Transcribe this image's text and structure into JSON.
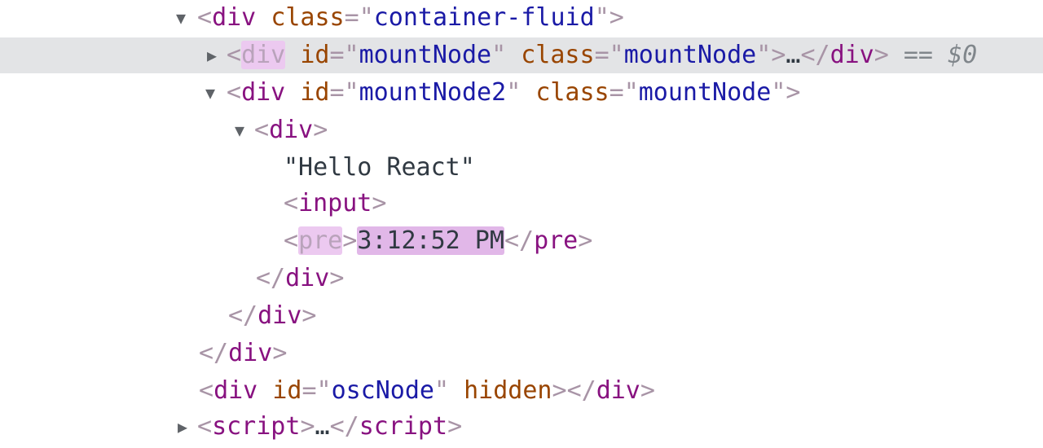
{
  "dom_tree": {
    "row1": {
      "open": "<",
      "tag": "div",
      "attr": "class",
      "eq": "=",
      "q1": "\"",
      "value": "container-fluid",
      "q2": "\"",
      "close": ">"
    },
    "row2": {
      "open": "<",
      "tag": "div",
      "attr1": "id",
      "eq1": "=",
      "q1": "\"",
      "value1": "mountNode",
      "q2": "\"",
      "attr2": "class",
      "eq2": "=",
      "q3": "\"",
      "value2": "mountNode",
      "q4": "\"",
      "close": ">",
      "ellipsis": "…",
      "end_open": "</",
      "end_tag": "div",
      "end_close": ">",
      "ref_eq": "==",
      "ref": "$0"
    },
    "row3": {
      "open": "<",
      "tag": "div",
      "attr1": "id",
      "eq1": "=",
      "q1": "\"",
      "value1": "mountNode2",
      "q2": "\"",
      "attr2": "class",
      "eq2": "=",
      "q3": "\"",
      "value2": "mountNode",
      "q4": "\"",
      "close": ">"
    },
    "row4": {
      "open": "<",
      "tag": "div",
      "close": ">"
    },
    "row5": {
      "text": "\"Hello React\""
    },
    "row6": {
      "open": "<",
      "tag": "input",
      "close": ">"
    },
    "row7": {
      "open": "<",
      "tag": "pre",
      "close": ">",
      "text": "3:12:52 PM",
      "end_open": "</",
      "end_tag": "pre",
      "end_close": ">"
    },
    "row8": {
      "end_open": "</",
      "end_tag": "div",
      "end_close": ">"
    },
    "row9": {
      "end_open": "</",
      "end_tag": "div",
      "end_close": ">"
    },
    "row10": {
      "end_open": "</",
      "end_tag": "div",
      "end_close": ">"
    },
    "row11": {
      "open": "<",
      "tag": "div",
      "attr1": "id",
      "eq1": "=",
      "q1": "\"",
      "value1": "oscNode",
      "q2": "\"",
      "attr2": "hidden",
      "close": ">",
      "end_open": "</",
      "end_tag": "div",
      "end_close": ">"
    },
    "row12": {
      "open": "<",
      "tag": "script",
      "close": ">",
      "ellipsis": "…",
      "end_open": "</",
      "end_tag": "script",
      "end_close": ">"
    }
  },
  "colors": {
    "tag": "#881280",
    "attribute": "#994500",
    "value": "#1a1aa6",
    "punctuation": "#a894a6",
    "text": "#303942",
    "selected_row": "#e3e4e6",
    "highlight": "#e1b7e8"
  },
  "icons": {
    "expanded": "triangle-down-icon",
    "collapsed": "triangle-right-icon"
  }
}
